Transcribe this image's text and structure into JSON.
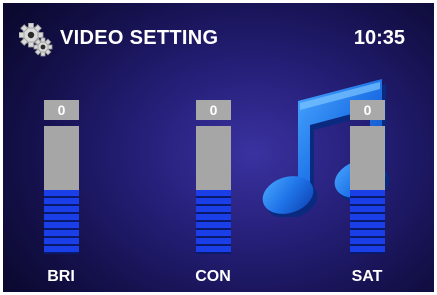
{
  "header": {
    "title": "VIDEO SETTING",
    "time": "10:35",
    "icon": "gear-icon"
  },
  "background_icon": "music-note-icon",
  "colors": {
    "background": "#1f1a6e",
    "accent": "#1a3fe8",
    "track": "#a6a6a6"
  },
  "sliders": [
    {
      "id": "bri",
      "label": "BRI",
      "value": "0",
      "level": 0.5
    },
    {
      "id": "con",
      "label": "CON",
      "value": "0",
      "level": 0.5
    },
    {
      "id": "sat",
      "label": "SAT",
      "value": "0",
      "level": 0.5
    }
  ]
}
